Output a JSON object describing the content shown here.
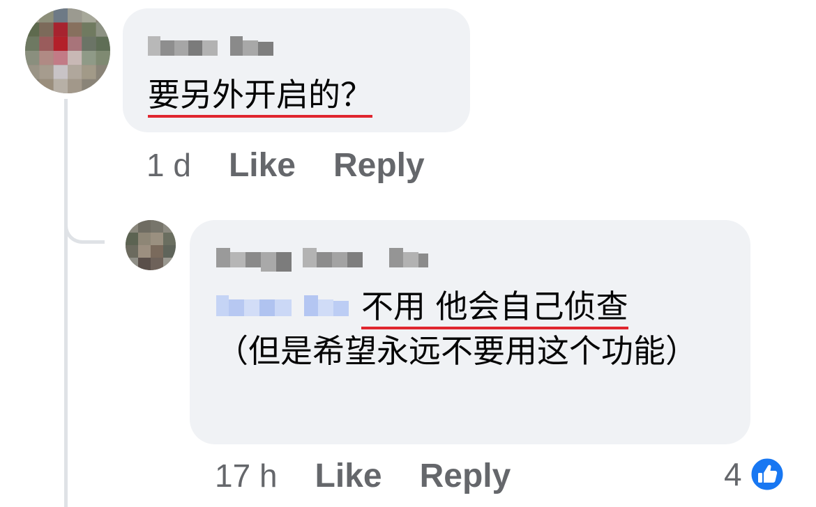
{
  "thread": {
    "parent_comment": {
      "author": "",
      "text": "要另外开启的？",
      "time": "1 d",
      "like_label": "Like",
      "reply_label": "Reply"
    },
    "reply_comment": {
      "author": "",
      "mention": "",
      "text_line_1": "不用 他会自己侦查",
      "text_rest": "（但是希望永远不要用这个功能）",
      "time": "17 h",
      "like_label": "Like",
      "reply_label": "Reply",
      "reaction_count": "4",
      "reaction_icon": "thumbs-up-icon"
    }
  },
  "colors": {
    "bubble": "#f0f2f5",
    "text": "#050505",
    "secondary_text": "#65676b",
    "underline": "#e0262f",
    "like_blue": "#1877f2"
  }
}
